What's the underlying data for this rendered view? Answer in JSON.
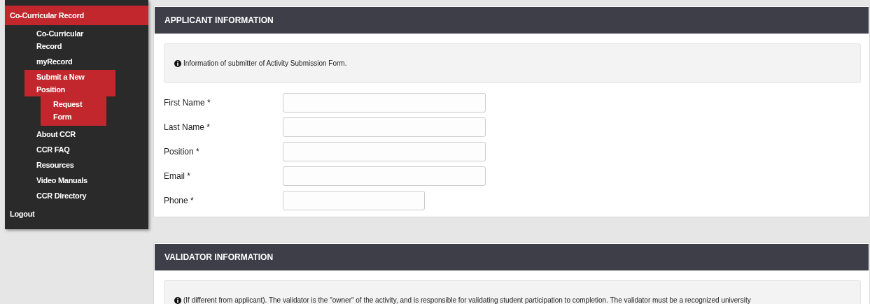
{
  "sidebar": {
    "items": [
      {
        "label": "Co-Curricular Record",
        "selected": true,
        "children": [
          {
            "label": "Co-Curricular Record",
            "selected": false
          },
          {
            "label": "myRecord",
            "selected": false
          },
          {
            "label": "Submit a New Position",
            "selected": true,
            "children": [
              {
                "label": "Request Form",
                "selected": true
              }
            ]
          },
          {
            "label": "About CCR",
            "selected": false
          },
          {
            "label": "CCR FAQ",
            "selected": false
          },
          {
            "label": "Resources",
            "selected": false
          },
          {
            "label": "Video Manuals",
            "selected": false
          },
          {
            "label": "CCR Directory",
            "selected": false
          }
        ]
      },
      {
        "label": "Logout",
        "selected": false
      }
    ]
  },
  "sections": [
    {
      "title": "APPLICANT INFORMATION",
      "info": "Information of submitter of Activity Submission Form.",
      "fields": [
        {
          "label": "First Name *",
          "kind": "long"
        },
        {
          "label": "Last Name *",
          "kind": "long"
        },
        {
          "label": "Position *",
          "kind": "long"
        },
        {
          "label": "Email *",
          "kind": "long"
        },
        {
          "label": "Phone *",
          "kind": "short"
        }
      ]
    },
    {
      "title": "VALIDATOR INFORMATION",
      "info": "(If different from applicant). The validator is the \"owner\" of the activity, and is responsible for validating student participation to completion. The validator must be a recognized university"
    }
  ]
}
